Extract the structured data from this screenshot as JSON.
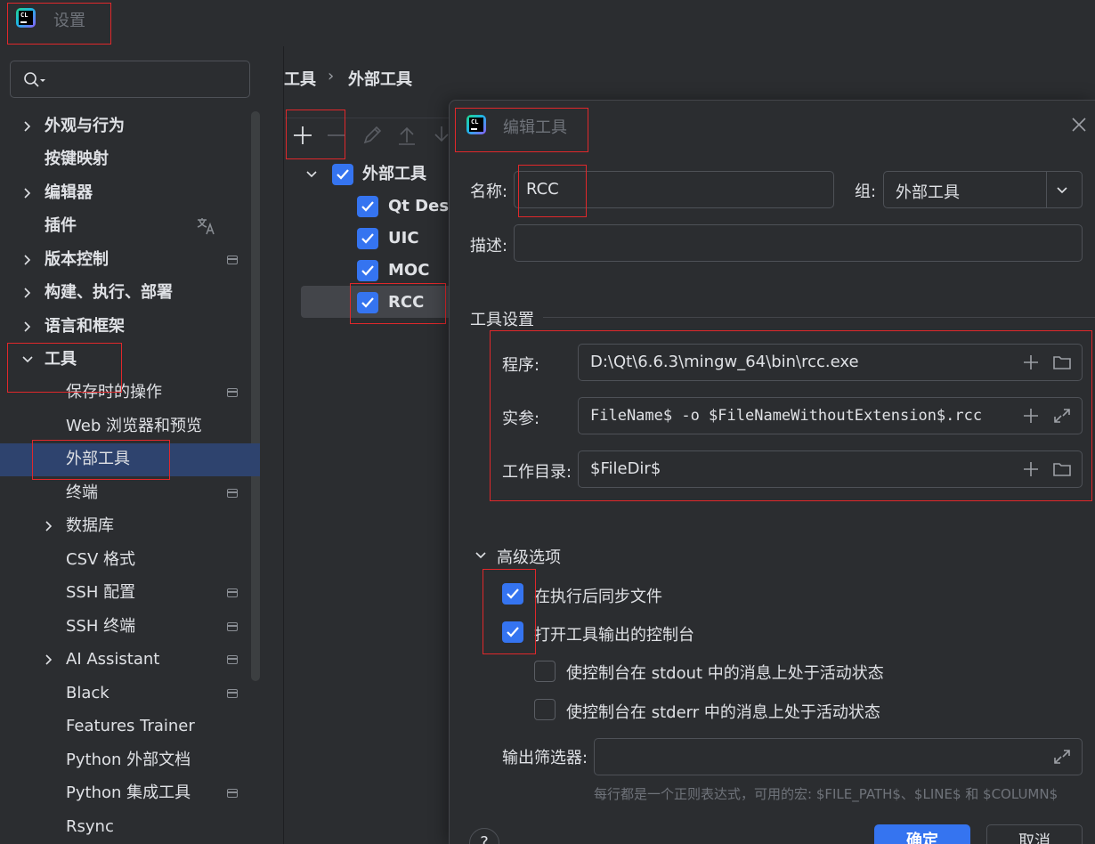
{
  "window": {
    "app_logo_text": "CL",
    "title": "设置"
  },
  "sidebar": {
    "search_placeholder": "",
    "items": [
      {
        "label": "外观与行为",
        "bold": true,
        "expand": "collapsed"
      },
      {
        "label": "按键映射",
        "bold": true
      },
      {
        "label": "编辑器",
        "bold": true,
        "expand": "collapsed"
      },
      {
        "label": "插件",
        "bold": true,
        "icon": "translate-icon"
      },
      {
        "label": "版本控制",
        "bold": true,
        "expand": "collapsed",
        "icon": "project-scope-icon"
      },
      {
        "label": "构建、执行、部署",
        "bold": true,
        "expand": "collapsed"
      },
      {
        "label": "语言和框架",
        "bold": true,
        "expand": "collapsed"
      },
      {
        "label": "工具",
        "bold": true,
        "expand": "expanded"
      },
      {
        "label": "保存时的操作",
        "icon": "project-scope-icon"
      },
      {
        "label": "Web 浏览器和预览"
      },
      {
        "label": "外部工具",
        "selected": true
      },
      {
        "label": "终端",
        "icon": "project-scope-icon"
      },
      {
        "label": "数据库",
        "expand": "collapsed"
      },
      {
        "label": "CSV 格式"
      },
      {
        "label": "SSH 配置",
        "icon": "project-scope-icon"
      },
      {
        "label": "SSH 终端",
        "icon": "project-scope-icon"
      },
      {
        "label": "AI Assistant",
        "expand": "collapsed",
        "icon": "project-scope-icon"
      },
      {
        "label": "Black",
        "icon": "project-scope-icon"
      },
      {
        "label": "Features Trainer"
      },
      {
        "label": "Python 外部文档"
      },
      {
        "label": "Python 集成工具",
        "icon": "project-scope-icon"
      },
      {
        "label": "Rsync"
      }
    ]
  },
  "breadcrumb": {
    "root": "工具",
    "separator": "›",
    "current": "外部工具"
  },
  "tools_tree": {
    "group": {
      "label": "外部工具",
      "checked": true
    },
    "items": [
      {
        "label": "Qt Designer",
        "checked": true
      },
      {
        "label": "UIC",
        "checked": true
      },
      {
        "label": "MOC",
        "checked": true
      },
      {
        "label": "RCC",
        "checked": true,
        "selected": true
      }
    ]
  },
  "dialog": {
    "title": "编辑工具",
    "name_label": "名称:",
    "name_value": "RCC",
    "group_label": "组:",
    "group_value": "外部工具",
    "description_label": "描述:",
    "description_value": "",
    "tool_settings_header": "工具设置",
    "program_label": "程序:",
    "program_value": "D:\\Qt\\6.6.3\\mingw_64\\bin\\rcc.exe",
    "arguments_label": "实参:",
    "arguments_value": "FileName$ -o $FileNameWithoutExtension$.rcc",
    "workdir_label": "工作目录:",
    "workdir_value": "$FileDir$",
    "advanced_header": "高级选项",
    "sync_files_label": "在执行后同步文件",
    "sync_files_checked": true,
    "open_console_label": "打开工具输出的控制台",
    "open_console_checked": true,
    "stdout_active_label": "使控制台在 stdout 中的消息上处于活动状态",
    "stdout_active_checked": false,
    "stderr_active_label": "使控制台在 stderr 中的消息上处于活动状态",
    "stderr_active_checked": false,
    "output_filter_label": "输出筛选器:",
    "output_filter_value": "",
    "output_filter_hint": "每行都是一个正则表达式，可用的宏: $FILE_PATH$、$LINE$ 和 $COLUMN$",
    "help_label": "?",
    "ok_label": "确定",
    "cancel_label": "取消"
  },
  "colors": {
    "background": "#2b2d30",
    "accent": "#3574f0",
    "selection": "#2e436e",
    "annotation": "#e0282b"
  }
}
